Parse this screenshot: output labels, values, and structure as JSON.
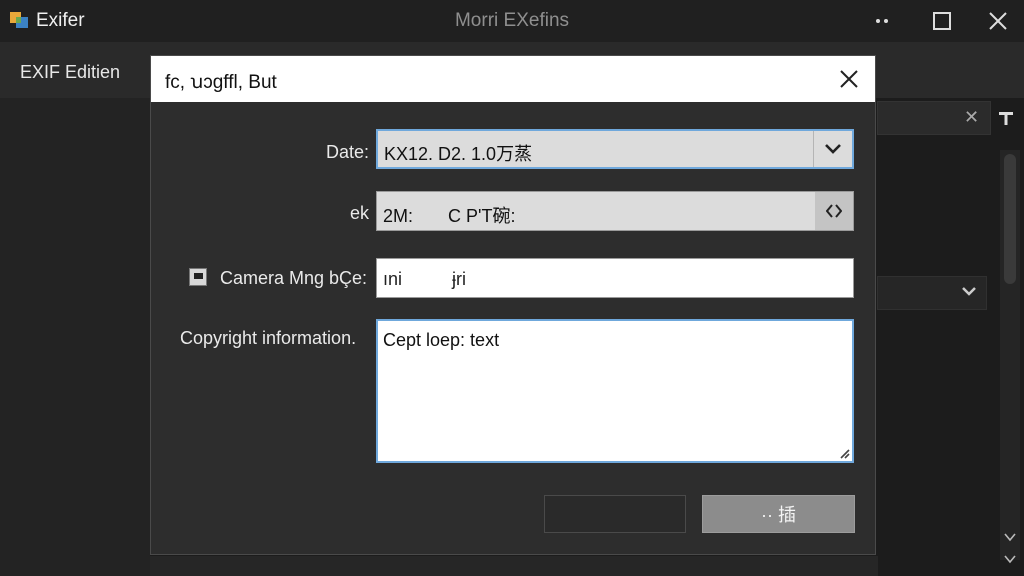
{
  "window": {
    "app_name": "Exifer",
    "title": "Morri EXefins",
    "icons": {
      "logo": "app-logo-icon",
      "minimize": "minimize-icon",
      "maximize": "maximize-icon",
      "close": "close-icon"
    }
  },
  "menu": {
    "exif_edit_label": "EXIF Editien"
  },
  "dialog": {
    "title": "fc, ꭒɔgffl, But",
    "fields": {
      "date_label": "Date:",
      "date_value": "KX12. D2. 1.0万蒸",
      "second_label": "ek",
      "second_value": "2M:       C P'T碗:",
      "camera_label": "Camera Mng bÇe:",
      "camera_checked": true,
      "camera_value": "ıni          ɉri",
      "copyright_label": "Copyright information.",
      "copyright_value": "Cept loep: text"
    },
    "buttons": {
      "secondary_label": "",
      "primary_label": "·· 插"
    }
  },
  "colors": {
    "accent": "#6fa8dc",
    "background": "#1e1e1e",
    "dialog_bg": "#2d2d2d"
  }
}
